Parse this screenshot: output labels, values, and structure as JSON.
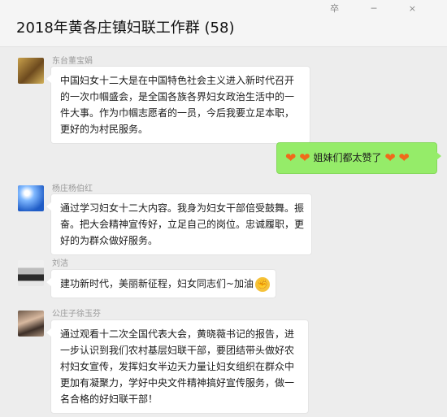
{
  "window": {
    "title": "2018年黄各庄镇妇联工作群 (58)",
    "controls": "卒 ─ ×"
  },
  "messages": [
    {
      "sender": "东台董宝娟",
      "text": "中国妇女十二大是在中国特色社会主义进入新时代召开的一次巾帼盛会，是全国各族各界妇女政治生活中的一件大事。作为巾帼志愿者的一员，今后我要立足本职，更好的为村民服务。",
      "avatar_icon": "user-avatar-flower"
    },
    {
      "sender": "",
      "text": "姐妹们都太赞了",
      "emoji_icon": "heart-emoji",
      "self": true
    },
    {
      "sender": "杨庄杨伯红",
      "text": "通过学习妇女十二大内容。我身为妇女干部倍受鼓舞。振奋。把大会精神宣传好，立足自己的岗位。忠诚履职，更好的为群众做好服务。",
      "avatar_icon": "user-avatar-sky"
    },
    {
      "sender": "刘洁",
      "text": "建功新时代，美丽新征程，妇女同志们~加油",
      "emoji_icon": "clap-emoji",
      "avatar_icon": "user-avatar-portrait"
    },
    {
      "sender": "公庄子徐玉芬",
      "text": "通过观看十二次全国代表大会，黄晓薇书记的报告，进一步认识到我们农村基层妇联干部，要团结带头做好农村妇女宣传，发挥妇女半边天力量让妇女组织在群众中更加有凝聚力，学好中央文件精神搞好宣传服务，做一名合格的好妇联干部！",
      "avatar_icon": "user-avatar-couple"
    }
  ],
  "colors": {
    "background": "#ededed",
    "self_bubble": "#95ec69",
    "other_bubble": "#ffffff",
    "sender_name": "#9a9a9a"
  }
}
